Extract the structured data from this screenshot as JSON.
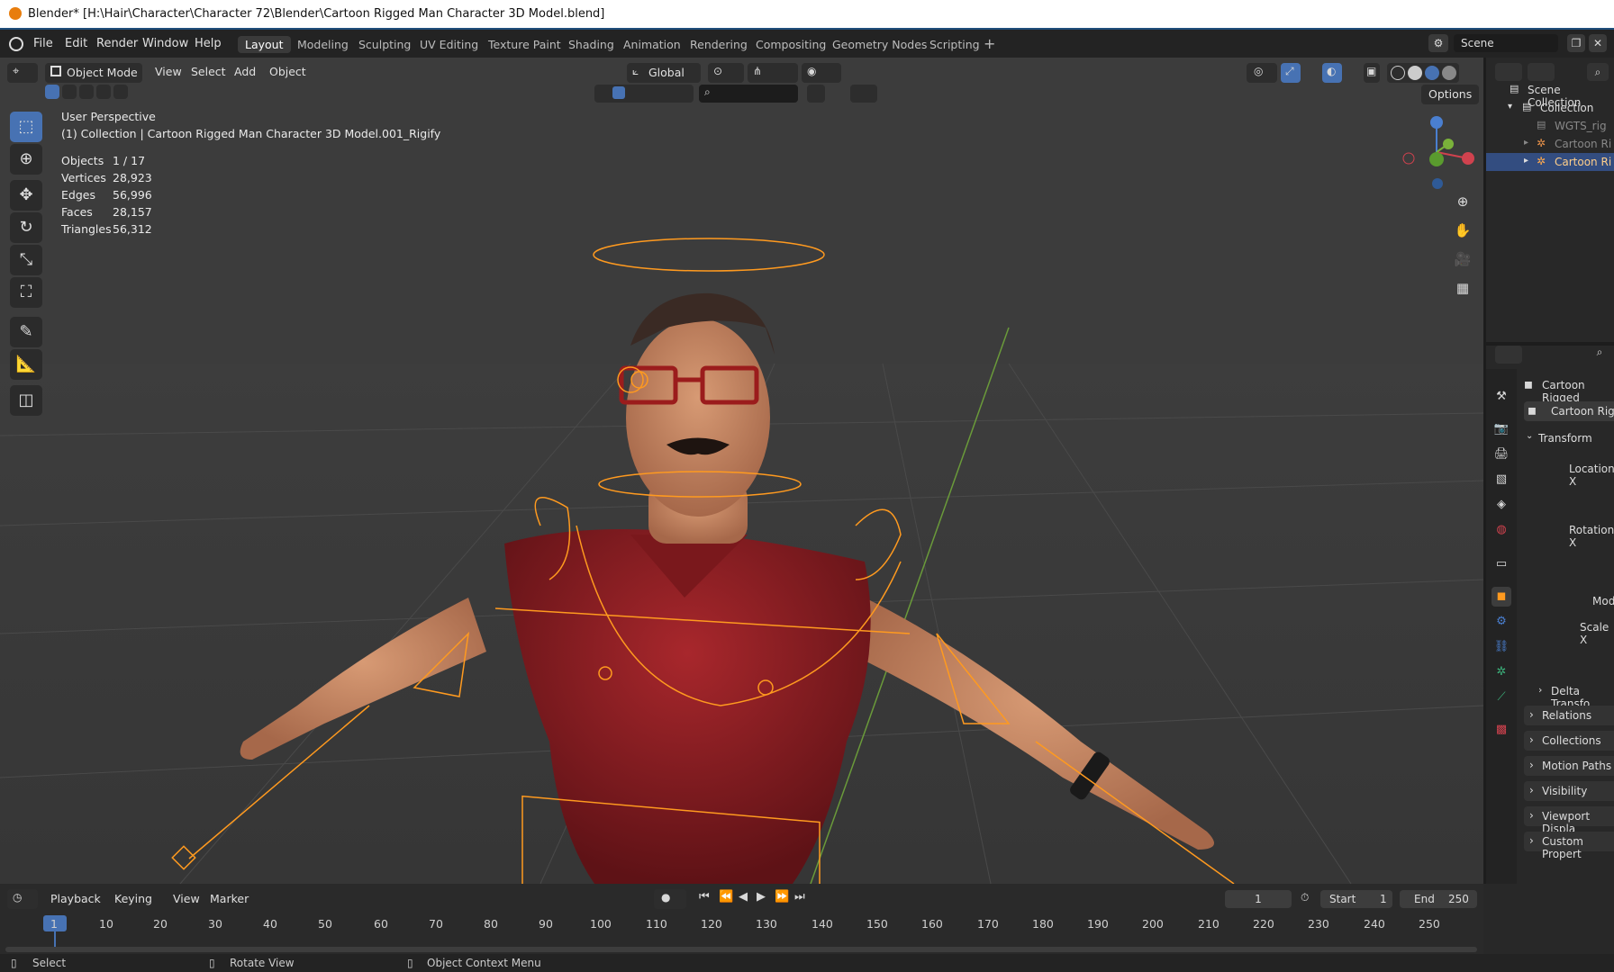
{
  "window": {
    "title": "Blender* [H:\\Hair\\Character\\Character 72\\Blender\\Cartoon Rigged Man Character 3D Model.blend]"
  },
  "menu": [
    "File",
    "Edit",
    "Render",
    "Window",
    "Help"
  ],
  "workspaces": [
    "Layout",
    "Modeling",
    "Sculpting",
    "UV Editing",
    "Texture Paint",
    "Shading",
    "Animation",
    "Rendering",
    "Compositing",
    "Geometry Nodes",
    "Scripting"
  ],
  "scene": {
    "name": "Scene"
  },
  "viewport_header": {
    "mode": "Object Mode",
    "menus": [
      "View",
      "Select",
      "Add",
      "Object"
    ],
    "orientation": "Global",
    "options_label": "Options"
  },
  "viewport_info": {
    "perspective": "User Perspective",
    "collection_line": "(1) Collection | Cartoon Rigged Man Character 3D Model.001_Rigify",
    "stats": [
      {
        "label": "Objects",
        "value": "1 / 17"
      },
      {
        "label": "Vertices",
        "value": "28,923"
      },
      {
        "label": "Edges",
        "value": "56,996"
      },
      {
        "label": "Faces",
        "value": "28,157"
      },
      {
        "label": "Triangles",
        "value": "56,312"
      }
    ]
  },
  "outliner": {
    "scene_collection": "Scene Collection",
    "collection": "Collection",
    "items": [
      "WGTS_rig",
      "Cartoon Ri",
      "Cartoon Ri"
    ]
  },
  "properties": {
    "object_name": "Cartoon Rigged",
    "object_data_name": "Cartoon Rigg",
    "transform_label": "Transform",
    "labels": [
      "Location X",
      "Rotation X",
      "Mode",
      "Scale X"
    ],
    "sections": [
      "Delta Transfo",
      "Relations",
      "Collections",
      "Motion Paths",
      "Visibility",
      "Viewport Displa",
      "Custom Propert"
    ]
  },
  "timeline": {
    "menus": [
      "Playback",
      "Keying",
      "View",
      "Marker"
    ],
    "current_frame": "1",
    "start_label": "Start",
    "start": "1",
    "end_label": "End",
    "end": "250",
    "ticks": [
      "1",
      "10",
      "20",
      "30",
      "40",
      "50",
      "60",
      "70",
      "80",
      "90",
      "100",
      "110",
      "120",
      "130",
      "140",
      "150",
      "160",
      "170",
      "180",
      "190",
      "200",
      "210",
      "220",
      "230",
      "240",
      "250"
    ]
  },
  "statusbar": {
    "select": "Select",
    "rotate": "Rotate View",
    "context": "Object Context Menu"
  },
  "colors": {
    "accent": "#4772b3",
    "selection_outline": "#ff9a1f",
    "shirt": "#8c1e22",
    "skin": "#c98a64"
  }
}
